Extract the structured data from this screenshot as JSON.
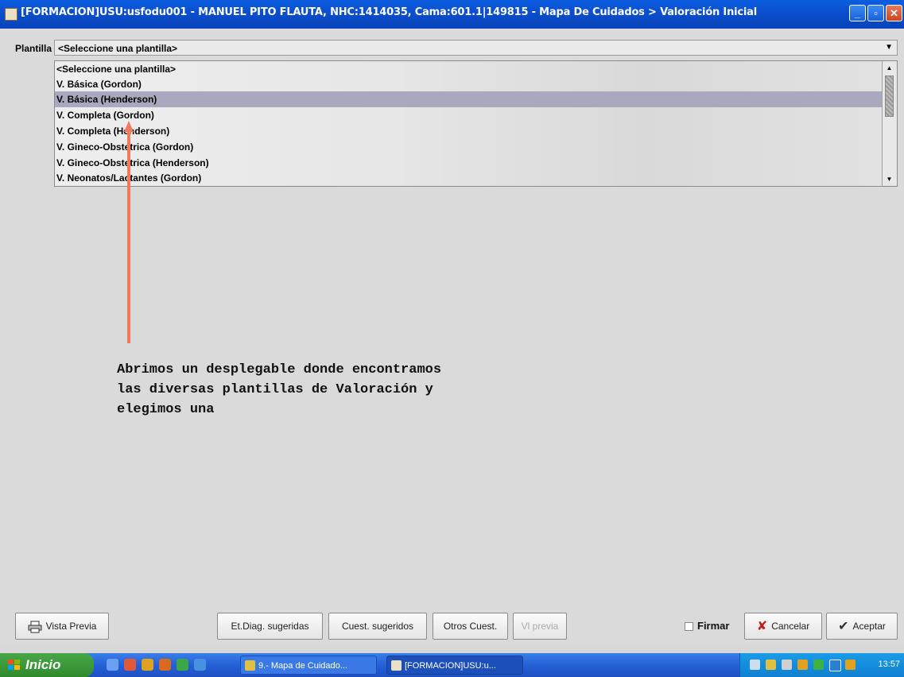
{
  "window": {
    "title": "[FORMACION]USU:usfodu001 - MANUEL PITO FLAUTA, NHC:1414035, Cama:601.1|149815 - Mapa De Cuidados > Valoración Inicial"
  },
  "form": {
    "plantilla_label": "Plantilla",
    "combo_value": "<Seleccione una plantilla>",
    "options": [
      "<Seleccione una plantilla>",
      "V. Básica (Gordon)",
      "V. Básica (Henderson)",
      "V. Completa (Gordon)",
      "V. Completa (Henderson)",
      "V. Gineco-Obstetrica (Gordon)",
      "V. Gineco-Obstetrica (Henderson)",
      "V. Neonatos/Lactantes (Gordon)"
    ],
    "selected_option": "V. Básica (Henderson)"
  },
  "annotation": {
    "text": "Abrimos un desplegable donde encontramos\nlas diversas plantillas de Valoración y\nelegimos una",
    "arrow_color": "#f07a5c"
  },
  "buttons": {
    "vista_previa": "Vista Previa",
    "et_diag": "Et.Diag. sugeridas",
    "cuest_sugeridos": "Cuest. sugeridos",
    "otros_cuest": "Otros Cuest.",
    "vi_previa": "Vl previa",
    "firmar": "Firmar",
    "cancelar": "Cancelar",
    "aceptar": "Aceptar"
  },
  "taskbar": {
    "start_label": "Inicio",
    "tasks": [
      "9.- Mapa de Cuidado...",
      "[FORMACION]USU:u..."
    ],
    "clock": "13:57"
  },
  "colors": {
    "titlebar": "#0a4fcf",
    "selected_row": "#a8a8be",
    "taskbar": "#2560d6",
    "start": "#3a9a38"
  }
}
